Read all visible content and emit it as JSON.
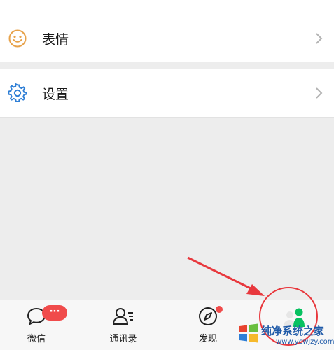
{
  "menu": {
    "items": [
      {
        "label": "表情",
        "icon": "smile-icon"
      },
      {
        "label": "设置",
        "icon": "gear-icon"
      }
    ]
  },
  "tabbar": {
    "tabs": [
      {
        "label": "微信",
        "icon": "chat-bubble-icon"
      },
      {
        "label": "通讯录",
        "icon": "contacts-icon"
      },
      {
        "label": "发现",
        "icon": "compass-icon"
      },
      {
        "label": "",
        "icon": "me-icon"
      }
    ],
    "chats_badge": "···",
    "selected_tab": "me"
  },
  "colors": {
    "background": "#ededed",
    "emoji_icon": "#e7a24a",
    "settings_icon": "#2f7fd6",
    "badge": "#f04b4b",
    "annotation": "#e8383d",
    "me_active": "#07c160"
  },
  "watermark": {
    "title": "纯净系统之家",
    "url": "www.ycwjzy.com"
  }
}
